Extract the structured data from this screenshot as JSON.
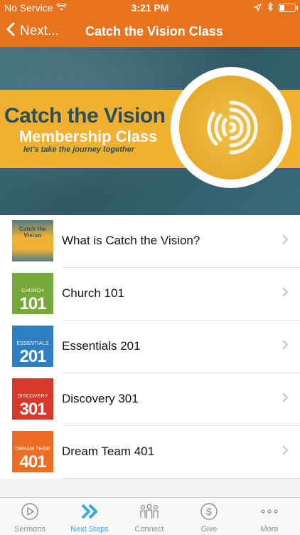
{
  "status_bar": {
    "carrier": "No Service",
    "time": "3:21 PM"
  },
  "nav": {
    "back_label": "Next...",
    "title": "Catch the Vision Class"
  },
  "hero": {
    "title": "Catch the Vision",
    "subtitle": "Membership Class",
    "tagline": "let's take the journey together"
  },
  "list": {
    "items": [
      {
        "label": "What is Catch the Vision?",
        "thumb_small": "Catch the Vision",
        "thumb_big": "",
        "color": "#f0b031"
      },
      {
        "label": "Church 101",
        "thumb_small": "CHURCH",
        "thumb_big": "101",
        "color": "#76a83a"
      },
      {
        "label": "Essentials 201",
        "thumb_small": "ESSENTIALS",
        "thumb_big": "201",
        "color": "#2b7fc2"
      },
      {
        "label": "Discovery 301",
        "thumb_small": "DISCOVERY",
        "thumb_big": "301",
        "color": "#d8382a"
      },
      {
        "label": "Dream Team 401",
        "thumb_small": "DREAM TEAM",
        "thumb_big": "401",
        "color": "#ec6d23"
      }
    ]
  },
  "tabbar": {
    "tabs": [
      {
        "label": "Sermons",
        "icon": "play-circle-icon"
      },
      {
        "label": "Next Steps",
        "icon": "double-chevron-icon"
      },
      {
        "label": "Connect",
        "icon": "people-icon"
      },
      {
        "label": "Give",
        "icon": "dollar-circle-icon"
      },
      {
        "label": "More",
        "icon": "ellipsis-icon"
      }
    ],
    "active": "Next Steps"
  },
  "colors": {
    "brand_orange": "#e8731f",
    "tab_active": "#3ba8df"
  }
}
